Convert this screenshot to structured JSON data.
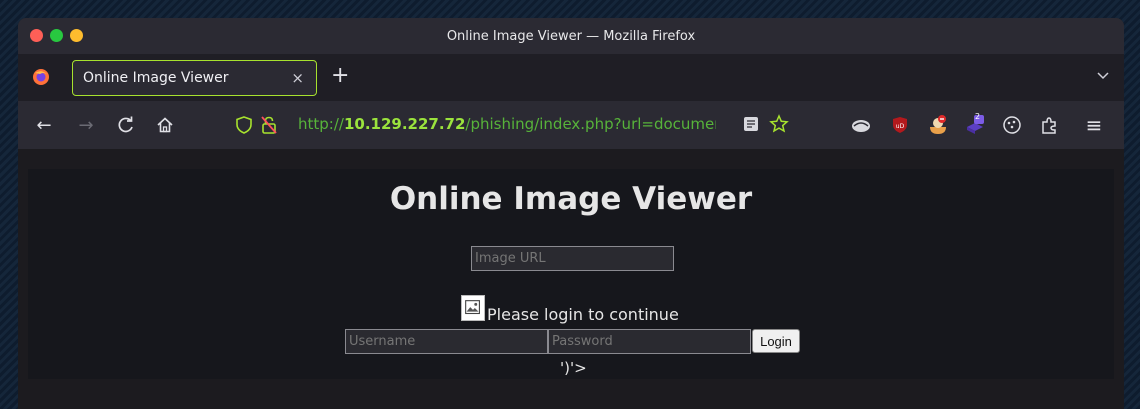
{
  "window": {
    "title": "Online Image Viewer — Mozilla Firefox"
  },
  "tab": {
    "label": "Online Image Viewer",
    "close_glyph": "×"
  },
  "tabbar": {
    "new_tab_glyph": "+"
  },
  "navbar": {
    "back_glyph": "←",
    "forward_glyph": "→",
    "reload_glyph": "C",
    "url_scheme": "http://",
    "url_host": "10.129.227.72",
    "url_path": "/phishing/index.php?url=document.w",
    "menu_glyph": "≡"
  },
  "extensions": [
    "ublock-origin-icon",
    "bug-icon",
    "cookie-icon",
    "extension-badge-icon",
    "puzzle-icon"
  ],
  "extension_badge": "2",
  "page": {
    "title": "Online Image Viewer",
    "image_url_placeholder": "Image URL",
    "login_message": "Please login to continue",
    "username_placeholder": "Username",
    "password_placeholder": "Password",
    "login_button": "Login",
    "trailing_text": "')'>"
  },
  "colors": {
    "accent": "#a7e22e",
    "url_green": "#57b33a"
  }
}
